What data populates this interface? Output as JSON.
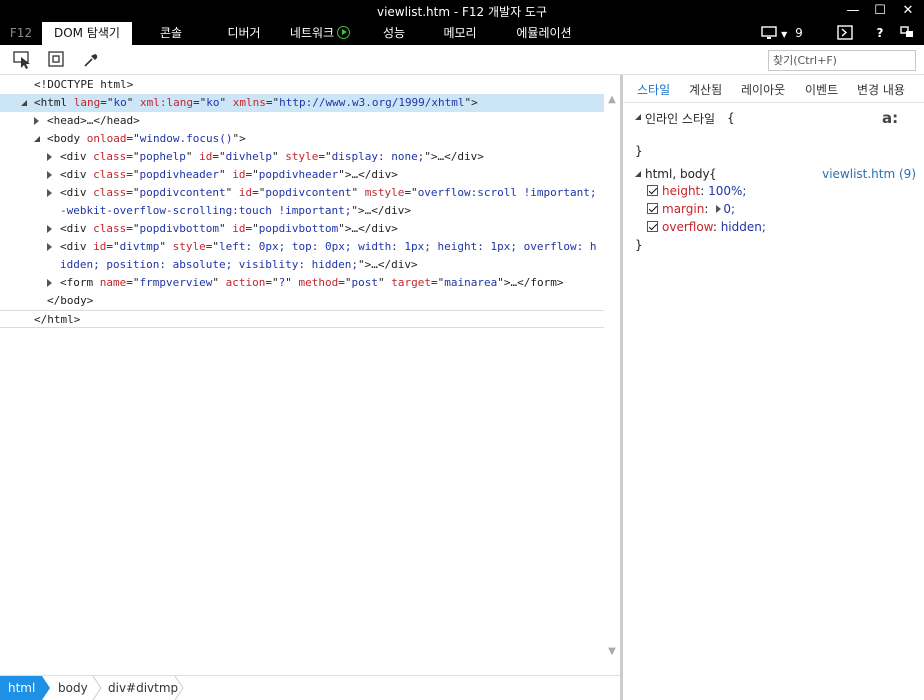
{
  "window": {
    "title": "viewlist.htm - F12 개발자 도구",
    "minimize": "—",
    "maximize": "☐",
    "close": "✕"
  },
  "tabs": {
    "f12": "F12",
    "items": [
      "DOM 탐색기",
      "콘솔",
      "디버거",
      "네트워크",
      "성능",
      "메모리",
      "에뮬레이션"
    ],
    "active_index": 0,
    "emulation_count": "9",
    "help": "?"
  },
  "toolbar": {
    "find_placeholder": "찾기(Ctrl+F)"
  },
  "dom": {
    "doctype": "<!DOCTYPE html>",
    "lines": [
      {
        "indent": 0,
        "parts": [
          [
            "t",
            "<html "
          ],
          [
            "a",
            "lang"
          ],
          [
            "t",
            "=\""
          ],
          [
            "v",
            "ko"
          ],
          [
            "t",
            "\" "
          ],
          [
            "a",
            "xml:lang"
          ],
          [
            "t",
            "=\""
          ],
          [
            "v",
            "ko"
          ],
          [
            "t",
            "\" "
          ],
          [
            "a",
            "xmlns"
          ],
          [
            "t",
            "=\""
          ],
          [
            "v",
            "http://www.w3.org/1999/xhtml"
          ],
          [
            "t",
            "\">"
          ]
        ]
      },
      {
        "indent": 1,
        "parts": [
          [
            "t",
            "<head>…</head>"
          ]
        ]
      },
      {
        "indent": 1,
        "parts": [
          [
            "t",
            "<body "
          ],
          [
            "a",
            "onload"
          ],
          [
            "t",
            "=\""
          ],
          [
            "v",
            "window.focus()"
          ],
          [
            "t",
            "\">"
          ]
        ]
      },
      {
        "indent": 2,
        "parts": [
          [
            "t",
            "<div "
          ],
          [
            "a",
            "class"
          ],
          [
            "t",
            "=\""
          ],
          [
            "v",
            "pophelp"
          ],
          [
            "t",
            "\" "
          ],
          [
            "a",
            "id"
          ],
          [
            "t",
            "=\""
          ],
          [
            "v",
            "divhelp"
          ],
          [
            "t",
            "\" "
          ],
          [
            "a",
            "style"
          ],
          [
            "t",
            "=\""
          ],
          [
            "v",
            "display: none;"
          ],
          [
            "t",
            "\">…</div>"
          ]
        ]
      },
      {
        "indent": 2,
        "parts": [
          [
            "t",
            "<div "
          ],
          [
            "a",
            "class"
          ],
          [
            "t",
            "=\""
          ],
          [
            "v",
            "popdivheader"
          ],
          [
            "t",
            "\" "
          ],
          [
            "a",
            "id"
          ],
          [
            "t",
            "=\""
          ],
          [
            "v",
            "popdivheader"
          ],
          [
            "t",
            "\">…</div>"
          ]
        ]
      },
      {
        "indent": 2,
        "parts": [
          [
            "t",
            "<div "
          ],
          [
            "a",
            "class"
          ],
          [
            "t",
            "=\""
          ],
          [
            "v",
            "popdivcontent"
          ],
          [
            "t",
            "\" "
          ],
          [
            "a",
            "id"
          ],
          [
            "t",
            "=\""
          ],
          [
            "v",
            "popdivcontent"
          ],
          [
            "t",
            "\" "
          ],
          [
            "a",
            "mstyle"
          ],
          [
            "t",
            "=\""
          ],
          [
            "v",
            "overflow:scroll !important;"
          ]
        ]
      },
      {
        "indent": 2,
        "cont": true,
        "parts": [
          [
            "v",
            "-webkit-overflow-scrolling:touch !important;"
          ],
          [
            "t",
            "\">…</div>"
          ]
        ]
      },
      {
        "indent": 2,
        "parts": [
          [
            "t",
            "<div "
          ],
          [
            "a",
            "class"
          ],
          [
            "t",
            "=\""
          ],
          [
            "v",
            "popdivbottom"
          ],
          [
            "t",
            "\" "
          ],
          [
            "a",
            "id"
          ],
          [
            "t",
            "=\""
          ],
          [
            "v",
            "popdivbottom"
          ],
          [
            "t",
            "\">…</div>"
          ]
        ]
      },
      {
        "indent": 2,
        "parts": [
          [
            "t",
            "<div "
          ],
          [
            "a",
            "id"
          ],
          [
            "t",
            "=\""
          ],
          [
            "v",
            "divtmp"
          ],
          [
            "t",
            "\" "
          ],
          [
            "a",
            "style"
          ],
          [
            "t",
            "=\""
          ],
          [
            "v",
            "left: 0px; top: 0px; width: 1px; height: 1px; overflow: h"
          ]
        ]
      },
      {
        "indent": 2,
        "cont": true,
        "parts": [
          [
            "v",
            "idden; position: absolute; visiblity: hidden;"
          ],
          [
            "t",
            "\">…</div>"
          ]
        ]
      },
      {
        "indent": 2,
        "parts": [
          [
            "t",
            "<form "
          ],
          [
            "a",
            "name"
          ],
          [
            "t",
            "=\""
          ],
          [
            "v",
            "frmpverview"
          ],
          [
            "t",
            "\" "
          ],
          [
            "a",
            "action"
          ],
          [
            "t",
            "=\""
          ],
          [
            "v",
            "?"
          ],
          [
            "t",
            "\" "
          ],
          [
            "a",
            "method"
          ],
          [
            "t",
            "=\""
          ],
          [
            "v",
            "post"
          ],
          [
            "t",
            "\" "
          ],
          [
            "a",
            "target"
          ],
          [
            "t",
            "=\""
          ],
          [
            "v",
            "mainarea"
          ],
          [
            "t",
            "\">…</form>"
          ]
        ]
      },
      {
        "indent": 1,
        "parts": [
          [
            "t",
            "</body>"
          ]
        ]
      },
      {
        "indent": 0,
        "parts": [
          [
            "t",
            "</html>"
          ]
        ]
      }
    ]
  },
  "breadcrumb": [
    "html",
    "body",
    "div#divtmp"
  ],
  "styles": {
    "tabs": [
      "스타일",
      "계산됨",
      "레이아웃",
      "이벤트",
      "변경 내용"
    ],
    "inline_label": "인라인 스타일",
    "open_brace": "{",
    "close_brace": "}",
    "rule_selector": "html, body",
    "rule_source": "viewlist.htm (9)",
    "properties": [
      {
        "name": "height",
        "value": "100%;"
      },
      {
        "name": "margin",
        "value": "0;"
      },
      {
        "name": "overflow",
        "value": "hidden;"
      }
    ]
  }
}
